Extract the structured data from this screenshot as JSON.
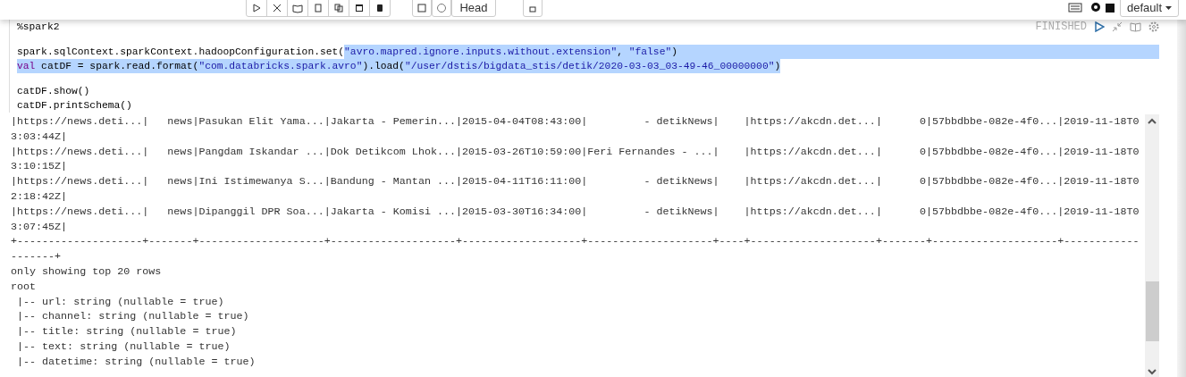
{
  "notebook_header": {
    "head_button": "Head",
    "interpreter_menu": "default"
  },
  "paragraph": {
    "status": "FINISHED",
    "code_lines": [
      {
        "kind": "code",
        "selected_eol": false,
        "segments": [
          {
            "text": "%spark2",
            "kind": "plain",
            "selected": false
          }
        ]
      },
      {
        "kind": "blank"
      },
      {
        "kind": "code",
        "selected_eol": true,
        "segments": [
          {
            "text": "spark.sqlContext.sparkContext.hadoopConfiguration.set(",
            "kind": "plain",
            "selected": false
          },
          {
            "text": "\"avro.mapred.ignore.inputs.without.extension\"",
            "kind": "string",
            "selected": true
          },
          {
            "text": ", ",
            "kind": "plain",
            "selected": true
          },
          {
            "text": "\"false\"",
            "kind": "string",
            "selected": true
          },
          {
            "text": ")",
            "kind": "plain",
            "selected": true
          }
        ]
      },
      {
        "kind": "code",
        "selected_eol": false,
        "segments": [
          {
            "text": "val",
            "kind": "keyword",
            "selected": true
          },
          {
            "text": " catDF = spark.read.format(",
            "kind": "plain",
            "selected": true
          },
          {
            "text": "\"com.databricks.spark.avro\"",
            "kind": "string",
            "selected": true
          },
          {
            "text": ").load(",
            "kind": "plain",
            "selected": true
          },
          {
            "text": "\"/user/dstis/bigdata_stis/detik/2020-03-03_03-49-46_00000000\"",
            "kind": "string",
            "selected": true
          },
          {
            "text": ")",
            "kind": "plain",
            "selected": true
          }
        ]
      },
      {
        "kind": "blank"
      },
      {
        "kind": "code",
        "selected_eol": false,
        "segments": [
          {
            "text": "catDF.show()",
            "kind": "plain",
            "selected": false
          }
        ]
      },
      {
        "kind": "code",
        "selected_eol": false,
        "segments": [
          {
            "text": "catDF.printSchema()",
            "kind": "plain",
            "selected": false
          }
        ]
      }
    ],
    "output_lines": [
      "|https://news.deti...|   news|Pasukan Elit Yama...|Jakarta - Pemerin...|2015-04-04T08:43:00|         - detikNews|    |https://akcdn.det...|      0|57bbdbbe-082e-4f0...|2019-11-18T0",
      "3:03:44Z|",
      "|https://news.deti...|   news|Pangdam Iskandar ...|Dok Detikcom Lhok...|2015-03-26T10:59:00|Feri Fernandes - ...|    |https://akcdn.det...|      0|57bbdbbe-082e-4f0...|2019-11-18T0",
      "3:10:15Z|",
      "|https://news.deti...|   news|Ini Istimewanya S...|Bandung - Mantan ...|2015-04-11T16:11:00|         - detikNews|    |https://akcdn.det...|      0|57bbdbbe-082e-4f0...|2019-11-18T0",
      "2:18:42Z|",
      "|https://news.deti...|   news|Dipanggil DPR Soa...|Jakarta - Komisi ...|2015-03-30T16:34:00|         - detikNews|    |https://akcdn.det...|      0|57bbdbbe-082e-4f0...|2019-11-18T0",
      "3:07:45Z|",
      "+--------------------+-------+--------------------+--------------------+-------------------+--------------------+----+--------------------+-------+--------------------+------------",
      "-------+",
      "only showing top 20 rows",
      "root",
      " |-- url: string (nullable = true)",
      " |-- channel: string (nullable = true)",
      " |-- title: string (nullable = true)",
      " |-- text: string (nullable = true)",
      " |-- datetime: string (nullable = true)"
    ]
  }
}
